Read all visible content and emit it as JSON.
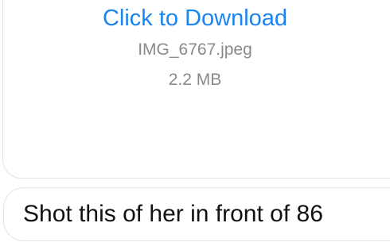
{
  "attachment": {
    "download_label": "Click to Download",
    "file_name": "IMG_6767.jpeg",
    "file_size": "2.2 MB"
  },
  "message": {
    "text": "Shot this of her in front of 86"
  },
  "colors": {
    "link": "#1a84f0",
    "meta_text": "#8a8a8e",
    "message_text": "#111111",
    "bubble_border": "#e3e3e8",
    "background": "#ffffff"
  }
}
